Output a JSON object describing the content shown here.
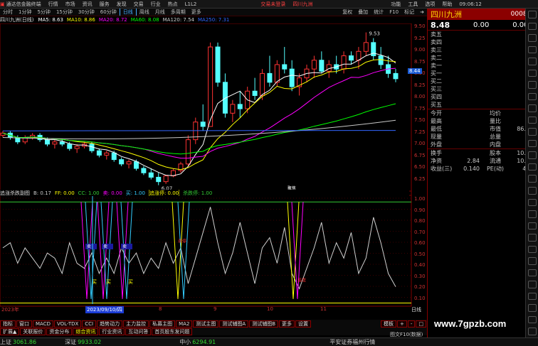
{
  "app": {
    "title": "通达信金融终端",
    "menu": [
      "行情",
      "市场",
      "资讯",
      "服务",
      "发现",
      "交易",
      "行业",
      "热点",
      "L1L2"
    ],
    "alert": "交易未登录",
    "alert_stock": "四川九洲",
    "window_controls": [
      "功能",
      "工具",
      "选项",
      "帮助"
    ]
  },
  "toolbar": {
    "periods": [
      "分时",
      "1分钟",
      "5分钟",
      "15分钟",
      "30分钟",
      "60分钟",
      "日线",
      "周线",
      "月线",
      "多周期",
      "更多"
    ],
    "active_period": "日线",
    "right_tools": [
      "复权",
      "叠加",
      "统计",
      "F10",
      "标记",
      "➜"
    ]
  },
  "chart_header": {
    "name": "四川九洲(日线)",
    "ma": [
      {
        "label": "MA5: 8.63",
        "color": "#ffffff"
      },
      {
        "label": "MA10: 8.86",
        "color": "#ffff00"
      },
      {
        "label": "MA20: 8.72",
        "color": "#ff00ff"
      },
      {
        "label": "MA60: 8.08",
        "color": "#00ff00"
      },
      {
        "label": "MA120: 7.54",
        "color": "#c8c8c8"
      },
      {
        "label": "MA250: 7.31",
        "color": "#3366ff"
      }
    ]
  },
  "price_axis": [
    "9.50",
    "9.25",
    "9.00",
    "8.75",
    "8.50",
    "8.25",
    "8.00",
    "7.75",
    "7.50",
    "7.25",
    "7.00",
    "6.75",
    "6.50",
    "6.25"
  ],
  "price_badge": "8.44",
  "annotations": {
    "high": "9.53",
    "low": "6.07",
    "marker": "聚焦"
  },
  "indicator": {
    "name": "追涨杀跌副图",
    "labels": [
      {
        "text": "B: 0.17",
        "color": "#c8c8c8"
      },
      {
        "text": "FF: 0.00",
        "color": "#ffff00"
      },
      {
        "text": "CC: 1.00",
        "color": "#33cc33"
      },
      {
        "text": "卖: 0.00",
        "color": "#ff00ff"
      },
      {
        "text": "买: 1.00",
        "color": "#33ccff"
      },
      {
        "text": "追涨停: 0.00",
        "color": "#ffff00"
      },
      {
        "text": "杀跌停: 1.00",
        "color": "#33cc33"
      }
    ],
    "axis": [
      "1.00",
      "0.90",
      "0.80",
      "0.70",
      "0.60",
      "0.50",
      "0.40",
      "0.30",
      "0.20",
      "0.10"
    ],
    "tags": {
      "sell": "卖",
      "buy": "买",
      "kill": "杀停",
      "chase": "追涨"
    }
  },
  "date_axis": {
    "year": "2023年",
    "date": "2023/09/10/四",
    "m1": "8",
    "m2": "9",
    "m3": "10",
    "m4": "11",
    "right": "日线"
  },
  "bottom_tabs1": [
    "指标",
    "窗口",
    "MACD",
    "VOL-TDX",
    "CCI",
    "趋势动力",
    "主力监控",
    "私募主图",
    "MA2",
    "测试主图",
    "测试辅图A",
    "测试辅图B",
    "更多",
    "设置"
  ],
  "bottom_tabs2": [
    "扩展▲",
    "关联报价",
    "资金分布",
    "综合资讯",
    "行业资讯",
    "互动问答",
    "首页股东发问题"
  ],
  "right_tools_bottom": [
    "模板",
    "+",
    "-",
    "□"
  ],
  "quote": {
    "price": "8.48",
    "change": "0.00",
    "change_pct": "0.00%",
    "stock_name": "四川九洲",
    "stock_code": "000801",
    "order_book": [
      {
        "label": "卖五",
        "price": "",
        "vol": ""
      },
      {
        "label": "卖四",
        "price": "",
        "vol": ""
      },
      {
        "label": "卖三",
        "price": "",
        "vol": ""
      },
      {
        "label": "卖二",
        "price": "",
        "vol": ""
      },
      {
        "label": "卖一",
        "price": "",
        "vol": ""
      },
      {
        "label": "买一",
        "price": "",
        "vol": ""
      },
      {
        "label": "买二",
        "price": "",
        "vol": ""
      },
      {
        "label": "买三",
        "price": "",
        "vol": ""
      },
      {
        "label": "买四",
        "price": "",
        "vol": ""
      },
      {
        "label": "买五",
        "price": "",
        "vol": ""
      }
    ],
    "stats": [
      {
        "l1": "今开",
        "v1": "",
        "l2": "均价",
        "v2": ""
      },
      {
        "l1": "最高",
        "v1": "",
        "l2": "量比",
        "v2": ""
      },
      {
        "l1": "最低",
        "v1": "",
        "l2": "市值",
        "v2": "86.7亿"
      },
      {
        "l1": "现量",
        "v1": "",
        "l2": "总量",
        "v2": ""
      },
      {
        "l1": "外盘",
        "v1": "",
        "l2": "内盘",
        "v2": ""
      }
    ],
    "fund": [
      {
        "l1": "换手",
        "v1": "",
        "l2": "股本",
        "v2": "10.2亿"
      },
      {
        "l1": "净资",
        "v1": "2.84",
        "l2": "流通",
        "v2": "10.2亿"
      },
      {
        "l1": "收益(三)",
        "v1": "0.140",
        "l2": "PE(动)",
        "v2": "46.1"
      }
    ]
  },
  "status": {
    "index1_name": "上证",
    "index1_val": "3061.86",
    "index2_name": "深证",
    "index2_val": "9933.02",
    "index3_name": "中小",
    "index3_val": "6294.91",
    "broker": "平安证券福州行情",
    "clock": "09:06:12",
    "watermark": "www.7gpzb.com",
    "f10": "图文F10(数据)"
  },
  "chart_data": {
    "type": "line",
    "x_range_label": "2023年 daily",
    "price_ylim": [
      6.0,
      9.7
    ],
    "candles": [
      [
        7.2,
        7.3,
        7.15,
        7.25
      ],
      [
        7.25,
        7.3,
        7.1,
        7.15
      ],
      [
        7.15,
        7.2,
        7.0,
        7.05
      ],
      [
        7.05,
        7.2,
        7.0,
        7.15
      ],
      [
        7.15,
        7.25,
        7.1,
        7.2
      ],
      [
        7.2,
        7.25,
        7.05,
        7.1
      ],
      [
        7.1,
        7.15,
        6.95,
        7.0
      ],
      [
        7.0,
        7.1,
        6.9,
        7.05
      ],
      [
        7.05,
        7.1,
        6.95,
        7.0
      ],
      [
        7.0,
        7.05,
        6.85,
        6.9
      ],
      [
        6.9,
        7.0,
        6.8,
        6.95
      ],
      [
        6.95,
        7.05,
        6.9,
        7.0
      ],
      [
        7.0,
        7.05,
        6.8,
        6.85
      ],
      [
        6.85,
        6.9,
        6.7,
        6.75
      ],
      [
        6.75,
        6.85,
        6.65,
        6.8
      ],
      [
        6.8,
        6.85,
        6.6,
        6.65
      ],
      [
        6.65,
        6.7,
        6.5,
        6.55
      ],
      [
        6.55,
        6.65,
        6.45,
        6.6
      ],
      [
        6.6,
        6.65,
        6.4,
        6.45
      ],
      [
        6.45,
        6.5,
        6.3,
        6.35
      ],
      [
        6.35,
        6.45,
        6.2,
        6.25
      ],
      [
        6.25,
        6.35,
        6.07,
        6.15
      ],
      [
        6.15,
        6.3,
        6.1,
        6.28
      ],
      [
        6.28,
        6.45,
        6.25,
        6.4
      ],
      [
        6.4,
        6.6,
        6.35,
        6.55
      ],
      [
        6.55,
        7.2,
        6.5,
        7.1
      ],
      [
        7.1,
        7.6,
        7.0,
        7.5
      ],
      [
        7.5,
        7.9,
        7.3,
        7.4
      ],
      [
        7.4,
        9.3,
        7.4,
        9.2
      ],
      [
        9.2,
        9.3,
        8.3,
        8.4
      ],
      [
        8.4,
        8.6,
        7.6,
        7.7
      ],
      [
        7.7,
        8.0,
        7.5,
        7.9
      ],
      [
        7.9,
        8.2,
        7.6,
        7.8
      ],
      [
        7.8,
        8.3,
        7.7,
        8.2
      ],
      [
        8.2,
        8.5,
        8.0,
        8.1
      ],
      [
        8.1,
        8.7,
        8.0,
        8.6
      ],
      [
        8.6,
        9.0,
        8.3,
        8.4
      ],
      [
        8.4,
        8.9,
        8.3,
        8.8
      ],
      [
        8.8,
        9.2,
        8.6,
        8.7
      ],
      [
        8.7,
        8.9,
        8.2,
        8.3
      ],
      [
        8.3,
        8.6,
        8.1,
        8.5
      ],
      [
        8.5,
        8.8,
        8.4,
        8.7
      ],
      [
        8.7,
        9.0,
        8.5,
        8.9
      ],
      [
        8.9,
        9.1,
        8.6,
        8.65
      ],
      [
        8.65,
        8.9,
        8.5,
        8.8
      ],
      [
        8.8,
        9.0,
        8.6,
        8.7
      ],
      [
        8.7,
        9.1,
        8.6,
        9.0
      ],
      [
        9.0,
        9.1,
        8.8,
        8.9
      ],
      [
        8.9,
        9.2,
        8.7,
        9.1
      ],
      [
        9.1,
        9.53,
        9.0,
        9.3
      ],
      [
        9.3,
        9.4,
        8.9,
        9.0
      ],
      [
        9.0,
        9.2,
        8.7,
        8.8
      ],
      [
        8.8,
        9.0,
        8.5,
        8.6
      ],
      [
        8.6,
        8.7,
        8.4,
        8.48
      ]
    ],
    "indicator_white": [
      0.55,
      0.6,
      0.4,
      0.55,
      0.45,
      0.35,
      0.5,
      0.45,
      0.3,
      0.6,
      0.4,
      0.35,
      0.5,
      0.3,
      0.45,
      0.3,
      0.55,
      0.4,
      0.5,
      0.3,
      0.45,
      0.35,
      0.6,
      0.4,
      0.55,
      0.2,
      0.45,
      0.7,
      0.95,
      0.6,
      0.3,
      0.5,
      0.8,
      0.5,
      0.2,
      0.55,
      0.65,
      0.4,
      0.75,
      0.3,
      0.15,
      0.35,
      0.55,
      0.8,
      0.4,
      0.6,
      0.45,
      0.7,
      0.3,
      0.45,
      0.85,
      0.6,
      0.3,
      0.17
    ],
    "ind_ylim": [
      0.0,
      1.05
    ]
  }
}
